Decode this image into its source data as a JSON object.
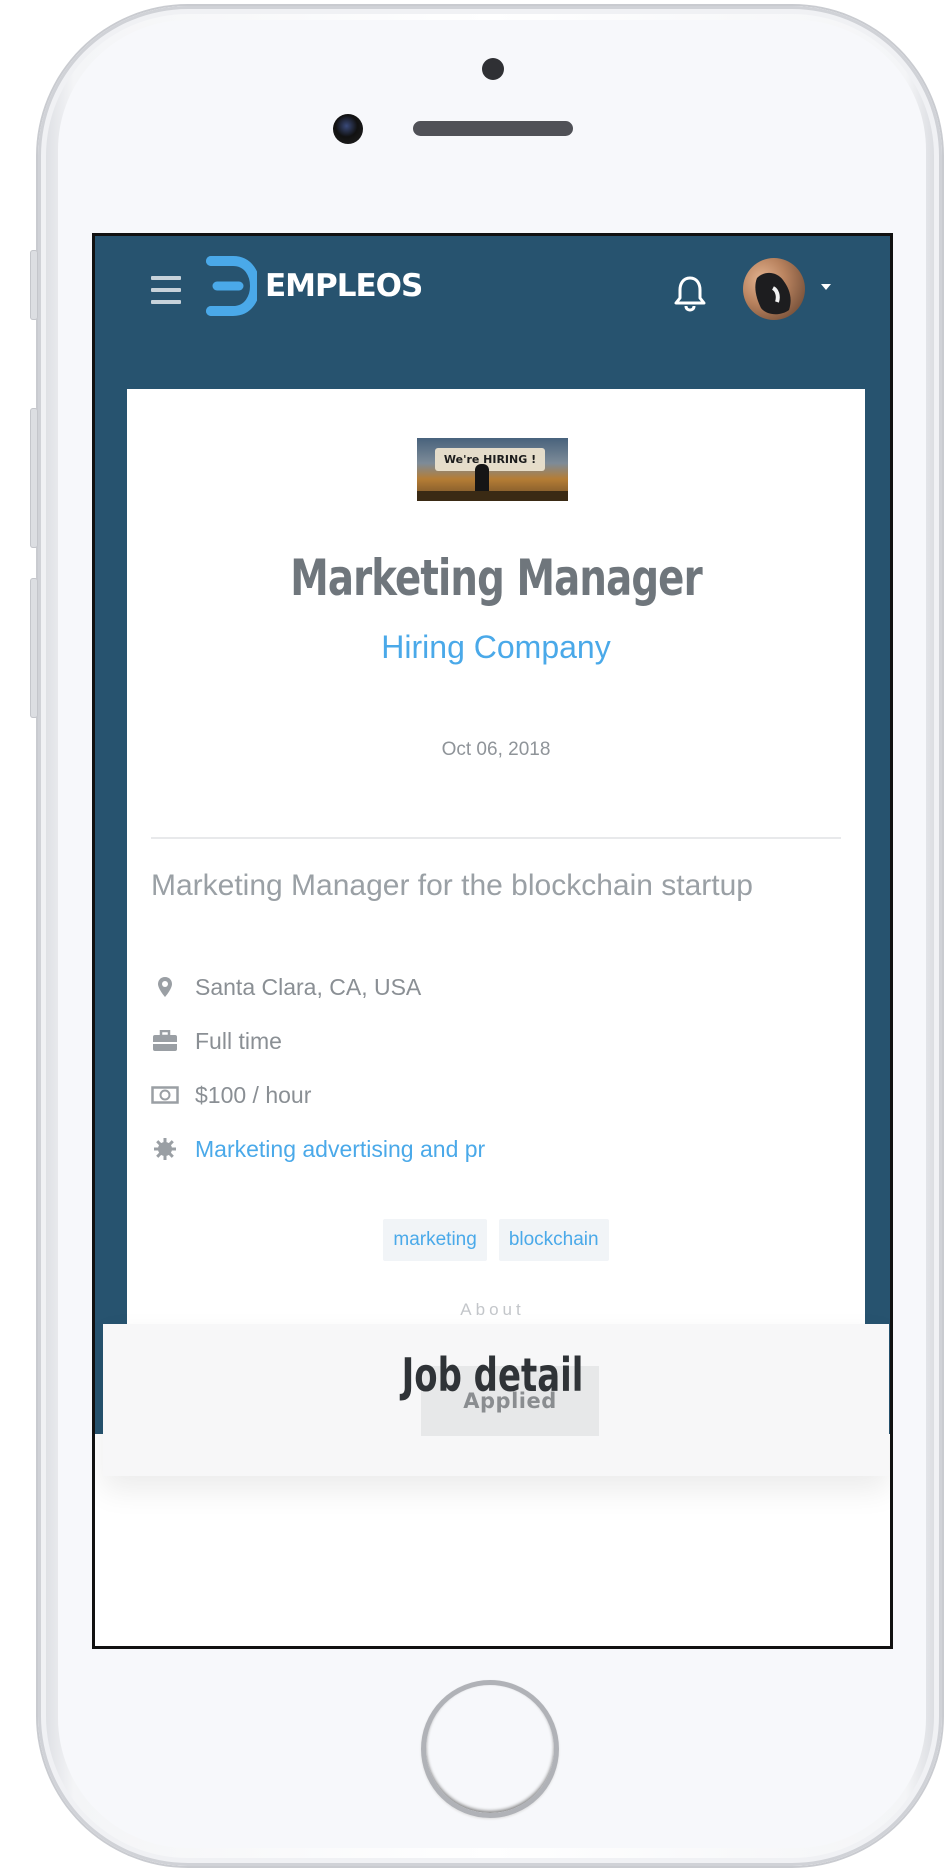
{
  "app": {
    "brand_name": "EMPLEOS",
    "brand_color": "#27536f",
    "accent_color": "#4aa9e9"
  },
  "nav": {
    "menu_icon": "hamburger-icon",
    "notification_icon": "bell-icon",
    "avatar_caret_icon": "caret-down-icon"
  },
  "job": {
    "image_banner_text": "We're HIRING !",
    "title": "Marketing Manager",
    "company": "Hiring Company",
    "date": "Oct 06, 2018",
    "summary": "Marketing Manager for the blockchain startup",
    "details": [
      {
        "icon": "map-marker-icon",
        "text": "Santa Clara, CA, USA"
      },
      {
        "icon": "briefcase-icon",
        "text": "Full time"
      },
      {
        "icon": "money-icon",
        "text": "$100 / hour"
      },
      {
        "icon": "gear-icon",
        "text": "Marketing advertising and pr"
      }
    ],
    "tags": [
      "marketing",
      "blockchain"
    ]
  },
  "apply": {
    "button_label": "Applied"
  },
  "about": {
    "label": "About",
    "section_title": "Job detail"
  }
}
